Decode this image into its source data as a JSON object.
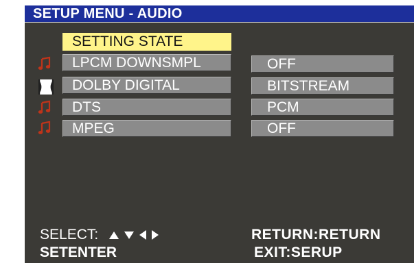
{
  "title": "SETUP MENU - AUDIO",
  "header_label": "SETTING STATE",
  "rows": [
    {
      "label": "LPCM DOWNSMPL",
      "value": "OFF",
      "icon": "music-note-icon"
    },
    {
      "label": "DOLBY DIGITAL",
      "value": "BITSTREAM",
      "icon": "dolby-icon"
    },
    {
      "label": "DTS",
      "value": "PCM",
      "icon": "music-note-icon"
    },
    {
      "label": "MPEG",
      "value": "OFF",
      "icon": "music-note-icon"
    }
  ],
  "footer": {
    "select_label": "SELECT:",
    "enter_label": "SETENTER",
    "return_label": "RETURN:RETURN",
    "exit_label": "EXIT:SERUP"
  },
  "colors": {
    "panel": "#3b3a36",
    "title_bar": "#1d2f9b",
    "highlight": "#fff48a",
    "row": "#8b8b8b",
    "note_icon": "#c0341a"
  }
}
